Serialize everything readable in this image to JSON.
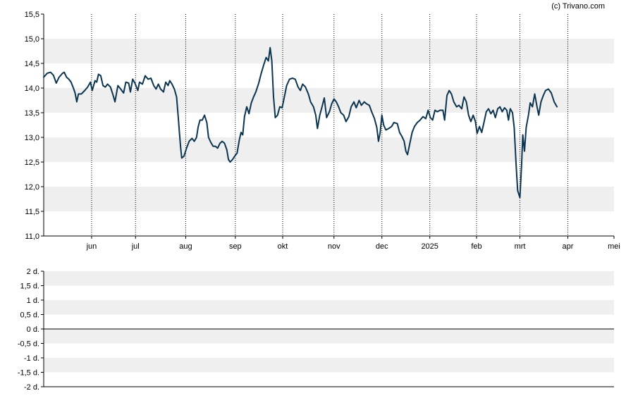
{
  "copyright": "(c) Trivano.com",
  "colors": {
    "line": "#0b3550",
    "band": "#efefef",
    "axis": "#000000"
  },
  "chart_data": [
    {
      "type": "line",
      "title": "",
      "xlabel": "",
      "ylabel": "",
      "ylim": [
        11.0,
        15.5
      ],
      "grid": true,
      "yticks": [
        15.5,
        15.0,
        14.5,
        14.0,
        13.5,
        13.0,
        12.5,
        12.0,
        11.5,
        11.0
      ],
      "ytick_labels": [
        "15,5",
        "15,0",
        "14,5",
        "14,0",
        "13,5",
        "13,0",
        "12,5",
        "12,0",
        "11,5",
        "11,0"
      ],
      "xlim": [
        0,
        1
      ],
      "xticks": [
        {
          "label": "jun",
          "x": 0.084
        },
        {
          "label": "jul",
          "x": 0.161
        },
        {
          "label": "aug",
          "x": 0.249
        },
        {
          "label": "sep",
          "x": 0.336
        },
        {
          "label": "okt",
          "x": 0.419
        },
        {
          "label": "nov",
          "x": 0.509
        },
        {
          "label": "dec",
          "x": 0.593
        },
        {
          "label": "2025",
          "x": 0.677
        },
        {
          "label": "feb",
          "x": 0.759
        },
        {
          "label": "mrt",
          "x": 0.835
        },
        {
          "label": "apr",
          "x": 0.919
        },
        {
          "label": "mei",
          "x": 1.0
        }
      ],
      "series": [
        {
          "values": [
            [
              0.0,
              14.22
            ],
            [
              0.006,
              14.3
            ],
            [
              0.012,
              14.32
            ],
            [
              0.017,
              14.26
            ],
            [
              0.022,
              14.1
            ],
            [
              0.027,
              14.22
            ],
            [
              0.033,
              14.3
            ],
            [
              0.036,
              14.32
            ],
            [
              0.04,
              14.22
            ],
            [
              0.044,
              14.18
            ],
            [
              0.048,
              14.12
            ],
            [
              0.052,
              14.0
            ],
            [
              0.055,
              13.9
            ],
            [
              0.058,
              13.72
            ],
            [
              0.061,
              13.88
            ],
            [
              0.066,
              13.88
            ],
            [
              0.072,
              13.95
            ],
            [
              0.077,
              14.02
            ],
            [
              0.082,
              14.12
            ],
            [
              0.085,
              13.95
            ],
            [
              0.09,
              14.15
            ],
            [
              0.093,
              14.12
            ],
            [
              0.096,
              14.28
            ],
            [
              0.1,
              14.25
            ],
            [
              0.104,
              14.05
            ],
            [
              0.108,
              14.02
            ],
            [
              0.112,
              14.08
            ],
            [
              0.117,
              14.02
            ],
            [
              0.121,
              13.88
            ],
            [
              0.125,
              13.72
            ],
            [
              0.13,
              14.05
            ],
            [
              0.135,
              13.98
            ],
            [
              0.14,
              13.9
            ],
            [
              0.144,
              14.12
            ],
            [
              0.149,
              14.1
            ],
            [
              0.152,
              13.92
            ],
            [
              0.156,
              14.18
            ],
            [
              0.16,
              14.1
            ],
            [
              0.165,
              13.95
            ],
            [
              0.168,
              14.12
            ],
            [
              0.173,
              14.08
            ],
            [
              0.178,
              14.25
            ],
            [
              0.183,
              14.18
            ],
            [
              0.188,
              14.2
            ],
            [
              0.193,
              14.05
            ],
            [
              0.197,
              13.98
            ],
            [
              0.201,
              14.08
            ],
            [
              0.205,
              13.98
            ],
            [
              0.21,
              13.92
            ],
            [
              0.214,
              14.12
            ],
            [
              0.218,
              14.05
            ],
            [
              0.221,
              14.15
            ],
            [
              0.225,
              14.08
            ],
            [
              0.229,
              13.98
            ],
            [
              0.233,
              13.82
            ],
            [
              0.236,
              13.4
            ],
            [
              0.238,
              13.1
            ],
            [
              0.24,
              12.8
            ],
            [
              0.242,
              12.58
            ],
            [
              0.246,
              12.62
            ],
            [
              0.251,
              12.8
            ],
            [
              0.255,
              12.92
            ],
            [
              0.26,
              12.98
            ],
            [
              0.264,
              12.92
            ],
            [
              0.268,
              13.0
            ],
            [
              0.271,
              13.22
            ],
            [
              0.274,
              13.35
            ],
            [
              0.278,
              13.35
            ],
            [
              0.282,
              13.45
            ],
            [
              0.286,
              13.3
            ],
            [
              0.289,
              13.0
            ],
            [
              0.293,
              12.9
            ],
            [
              0.297,
              12.82
            ],
            [
              0.301,
              12.82
            ],
            [
              0.305,
              12.78
            ],
            [
              0.309,
              12.88
            ],
            [
              0.313,
              12.92
            ],
            [
              0.317,
              12.88
            ],
            [
              0.321,
              12.75
            ],
            [
              0.324,
              12.55
            ],
            [
              0.327,
              12.5
            ],
            [
              0.331,
              12.55
            ],
            [
              0.335,
              12.62
            ],
            [
              0.339,
              12.68
            ],
            [
              0.343,
              12.95
            ],
            [
              0.346,
              13.1
            ],
            [
              0.349,
              13.05
            ],
            [
              0.352,
              13.42
            ],
            [
              0.356,
              13.62
            ],
            [
              0.36,
              13.48
            ],
            [
              0.364,
              13.7
            ],
            [
              0.368,
              13.82
            ],
            [
              0.372,
              13.92
            ],
            [
              0.377,
              14.1
            ],
            [
              0.381,
              14.28
            ],
            [
              0.386,
              14.48
            ],
            [
              0.39,
              14.62
            ],
            [
              0.394,
              14.55
            ],
            [
              0.397,
              14.82
            ],
            [
              0.4,
              14.55
            ],
            [
              0.403,
              13.82
            ],
            [
              0.406,
              13.4
            ],
            [
              0.41,
              13.45
            ],
            [
              0.414,
              13.62
            ],
            [
              0.418,
              13.6
            ],
            [
              0.422,
              13.82
            ],
            [
              0.426,
              14.05
            ],
            [
              0.431,
              14.18
            ],
            [
              0.436,
              14.2
            ],
            [
              0.441,
              14.18
            ],
            [
              0.446,
              14.02
            ],
            [
              0.45,
              13.95
            ],
            [
              0.454,
              14.08
            ],
            [
              0.459,
              14.02
            ],
            [
              0.464,
              13.88
            ],
            [
              0.468,
              13.72
            ],
            [
              0.473,
              13.62
            ],
            [
              0.477,
              13.45
            ],
            [
              0.48,
              13.18
            ],
            [
              0.484,
              13.45
            ],
            [
              0.488,
              13.62
            ],
            [
              0.492,
              13.8
            ],
            [
              0.496,
              13.4
            ],
            [
              0.501,
              13.52
            ],
            [
              0.505,
              13.68
            ],
            [
              0.509,
              13.78
            ],
            [
              0.513,
              13.72
            ],
            [
              0.517,
              13.62
            ],
            [
              0.521,
              13.5
            ],
            [
              0.526,
              13.45
            ],
            [
              0.53,
              13.32
            ],
            [
              0.535,
              13.42
            ],
            [
              0.539,
              13.62
            ],
            [
              0.544,
              13.72
            ],
            [
              0.548,
              13.6
            ],
            [
              0.553,
              13.75
            ],
            [
              0.557,
              13.65
            ],
            [
              0.562,
              13.72
            ],
            [
              0.566,
              13.68
            ],
            [
              0.571,
              13.65
            ],
            [
              0.575,
              13.52
            ],
            [
              0.58,
              13.38
            ],
            [
              0.584,
              13.2
            ],
            [
              0.587,
              12.92
            ],
            [
              0.59,
              13.1
            ],
            [
              0.593,
              13.45
            ],
            [
              0.596,
              13.25
            ],
            [
              0.6,
              13.15
            ],
            [
              0.605,
              13.18
            ],
            [
              0.61,
              13.22
            ],
            [
              0.614,
              13.3
            ],
            [
              0.62,
              13.28
            ],
            [
              0.624,
              13.1
            ],
            [
              0.628,
              13.02
            ],
            [
              0.632,
              12.92
            ],
            [
              0.635,
              12.72
            ],
            [
              0.638,
              12.65
            ],
            [
              0.642,
              12.88
            ],
            [
              0.646,
              13.1
            ],
            [
              0.65,
              13.22
            ],
            [
              0.655,
              13.3
            ],
            [
              0.66,
              13.35
            ],
            [
              0.665,
              13.42
            ],
            [
              0.67,
              13.38
            ],
            [
              0.674,
              13.55
            ],
            [
              0.678,
              13.4
            ],
            [
              0.682,
              13.35
            ],
            [
              0.686,
              13.55
            ],
            [
              0.69,
              13.52
            ],
            [
              0.695,
              13.55
            ],
            [
              0.7,
              13.55
            ],
            [
              0.703,
              13.35
            ],
            [
              0.707,
              13.85
            ],
            [
              0.711,
              13.95
            ],
            [
              0.715,
              13.88
            ],
            [
              0.719,
              13.72
            ],
            [
              0.724,
              13.62
            ],
            [
              0.728,
              13.65
            ],
            [
              0.733,
              13.58
            ],
            [
              0.737,
              13.82
            ],
            [
              0.741,
              13.72
            ],
            [
              0.745,
              13.45
            ],
            [
              0.749,
              13.32
            ],
            [
              0.753,
              13.45
            ],
            [
              0.757,
              13.32
            ],
            [
              0.76,
              13.08
            ],
            [
              0.764,
              13.22
            ],
            [
              0.768,
              13.1
            ],
            [
              0.772,
              13.3
            ],
            [
              0.776,
              13.52
            ],
            [
              0.78,
              13.58
            ],
            [
              0.784,
              13.48
            ],
            [
              0.788,
              13.55
            ],
            [
              0.792,
              13.4
            ],
            [
              0.796,
              13.58
            ],
            [
              0.8,
              13.62
            ],
            [
              0.804,
              13.52
            ],
            [
              0.808,
              13.6
            ],
            [
              0.812,
              13.55
            ],
            [
              0.815,
              13.35
            ],
            [
              0.818,
              13.58
            ],
            [
              0.822,
              13.5
            ],
            [
              0.825,
              13.2
            ],
            [
              0.828,
              12.5
            ],
            [
              0.831,
              11.92
            ],
            [
              0.835,
              11.78
            ],
            [
              0.838,
              12.45
            ],
            [
              0.84,
              13.05
            ],
            [
              0.843,
              12.72
            ],
            [
              0.846,
              13.2
            ],
            [
              0.85,
              13.45
            ],
            [
              0.853,
              13.7
            ],
            [
              0.857,
              13.62
            ],
            [
              0.861,
              13.88
            ],
            [
              0.865,
              13.62
            ],
            [
              0.868,
              13.45
            ],
            [
              0.872,
              13.72
            ],
            [
              0.876,
              13.85
            ],
            [
              0.88,
              13.95
            ],
            [
              0.885,
              13.98
            ],
            [
              0.89,
              13.9
            ],
            [
              0.895,
              13.72
            ],
            [
              0.9,
              13.62
            ]
          ]
        }
      ]
    },
    {
      "type": "line",
      "title": "",
      "xlabel": "",
      "ylabel": "",
      "ylim": [
        -2,
        2
      ],
      "grid": true,
      "yticks": [
        2,
        1.5,
        1,
        0.5,
        0,
        -0.5,
        -1,
        -1.5,
        -2
      ],
      "ytick_labels": [
        "2 d.",
        "1,5 d.",
        "1 d.",
        "0,5 d.",
        "0 d.",
        "-0,5 d.",
        "-1 d.",
        "-1,5 d.",
        "-2 d."
      ],
      "zero_line": 0,
      "series": []
    }
  ]
}
